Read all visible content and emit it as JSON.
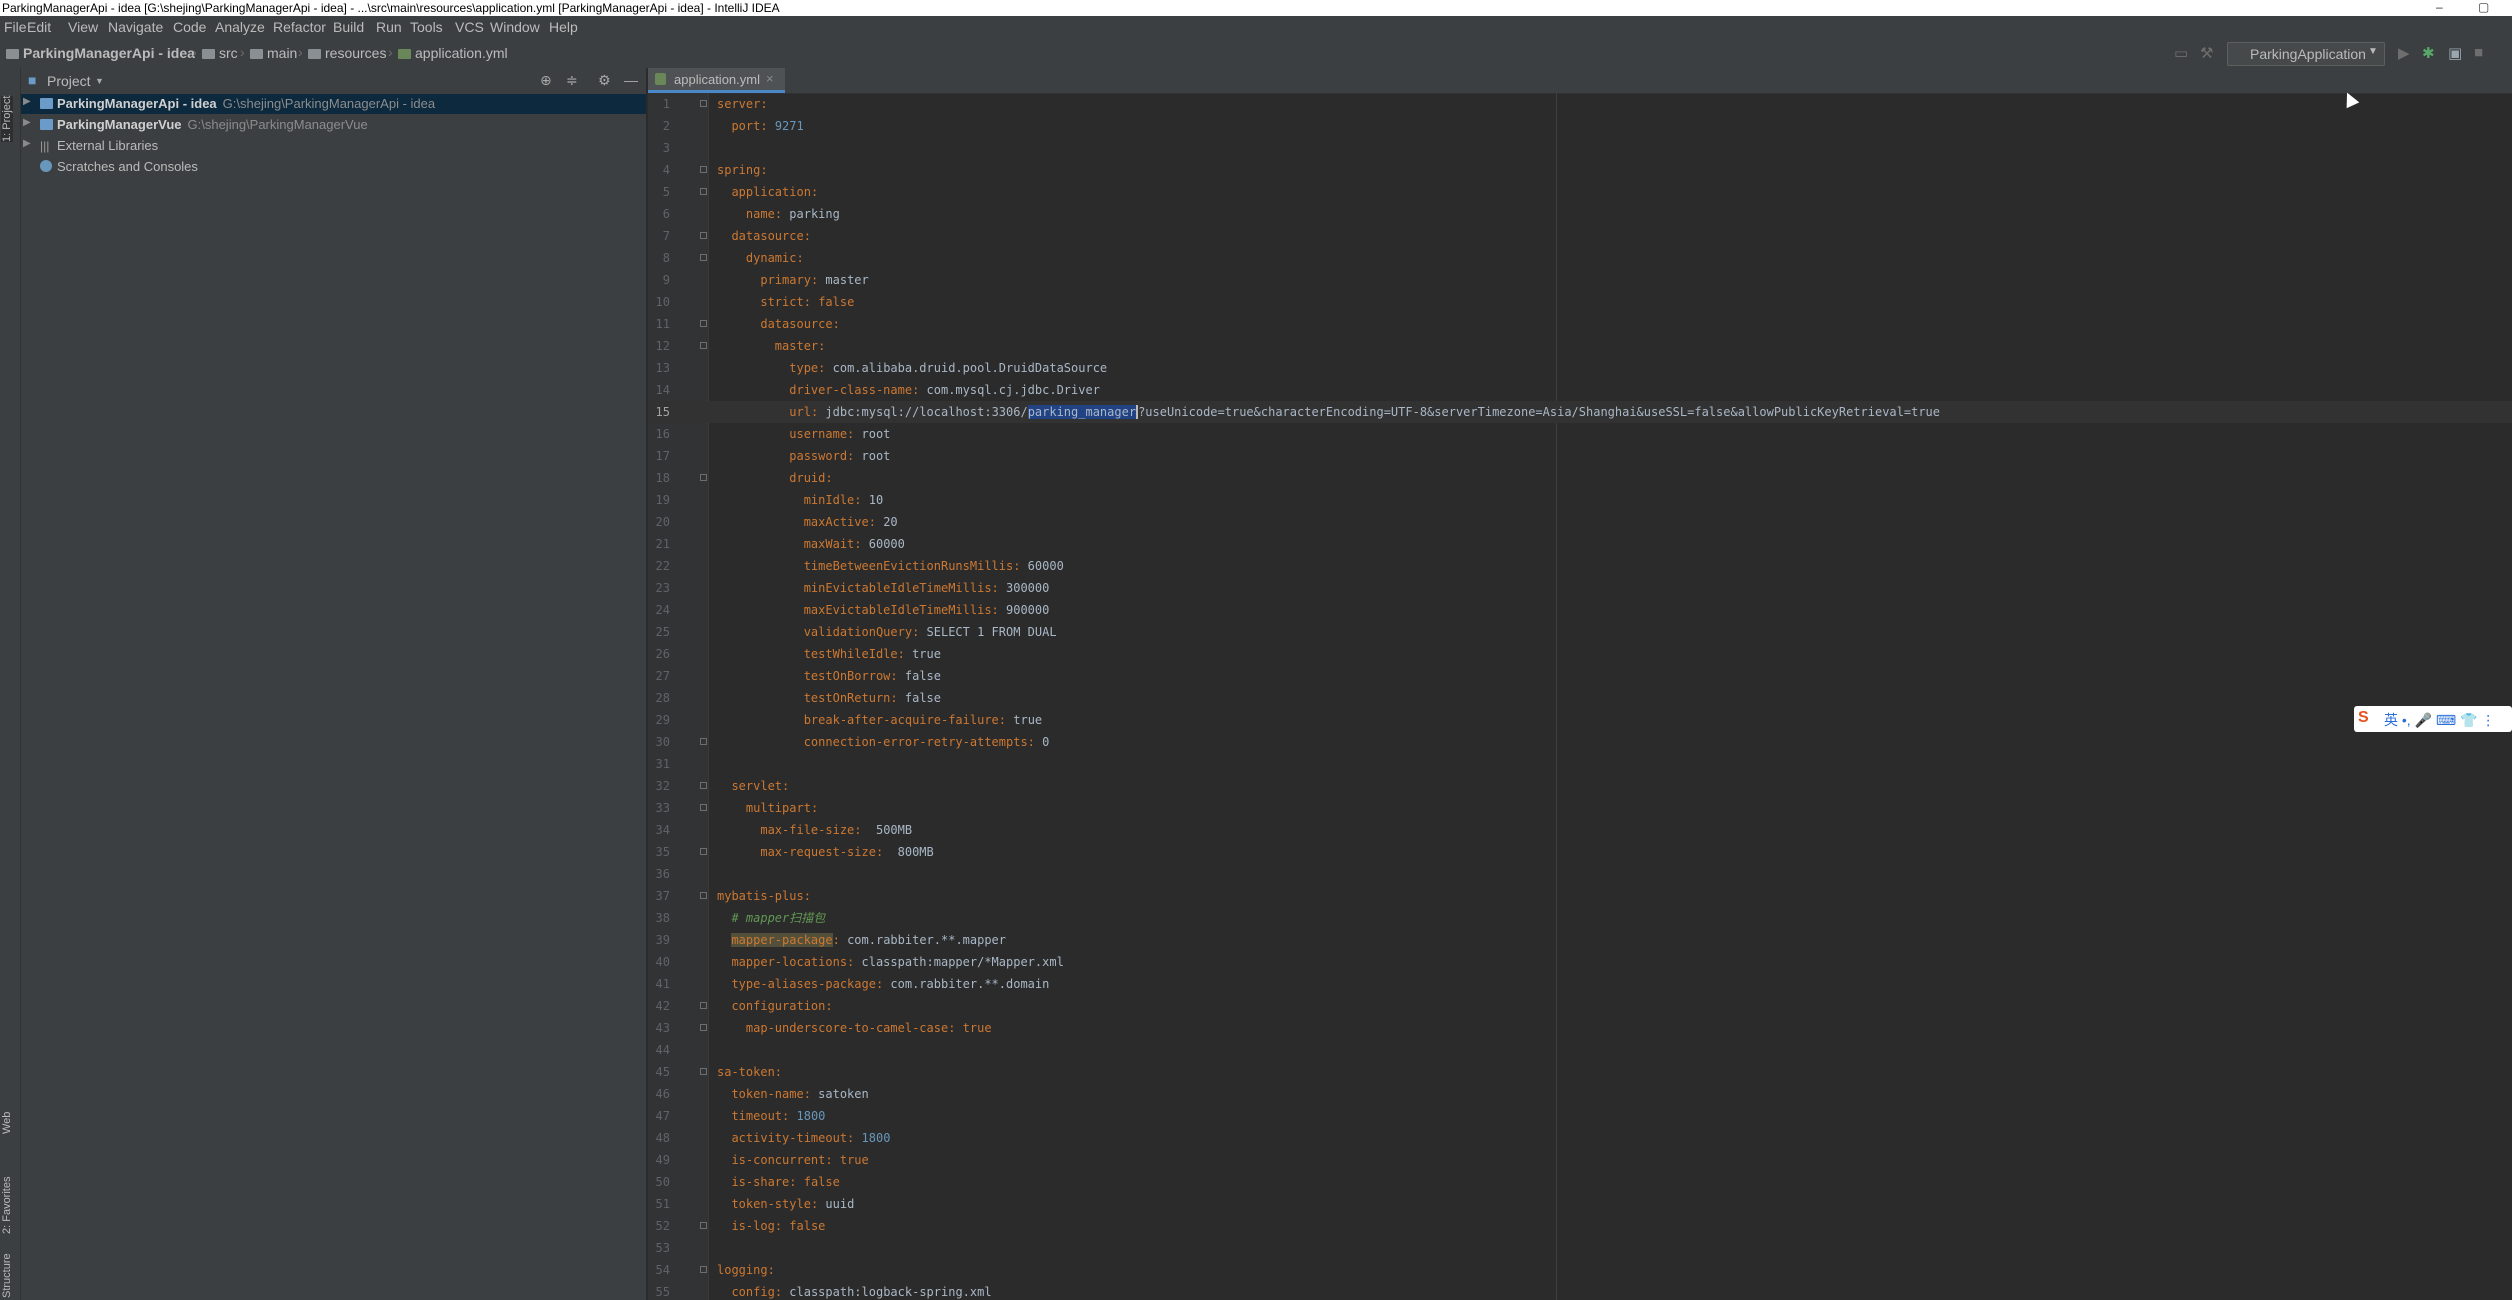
{
  "window": {
    "title": "ParkingManagerApi - idea [G:\\shejing\\ParkingManagerApi - idea] - ...\\src\\main\\resources\\application.yml [ParkingManagerApi - idea] - IntelliJ IDEA",
    "minimize": "–",
    "maximize": "▢"
  },
  "menu": [
    "File",
    "Edit",
    "View",
    "Navigate",
    "Code",
    "Analyze",
    "Refactor",
    "Build",
    "Run",
    "Tools",
    "VCS",
    "Window",
    "Help"
  ],
  "breadcrumb": [
    "ParkingManagerApi - idea",
    "src",
    "main",
    "resources",
    "application.yml"
  ],
  "run_config": "ParkingApplication",
  "project_panel": {
    "title": "Project",
    "items": [
      {
        "name": "ParkingManagerApi - idea",
        "path": "G:\\shejing\\ParkingManagerApi - idea"
      },
      {
        "name": "ParkingManagerVue",
        "path": "G:\\shejing\\ParkingManagerVue"
      },
      {
        "name": "External Libraries",
        "path": ""
      },
      {
        "name": "Scratches and Consoles",
        "path": ""
      }
    ]
  },
  "side_tabs": {
    "project": "1: Project",
    "web": "Web",
    "favorites": "2: Favorites",
    "structure": "Structure"
  },
  "editor": {
    "tab": "application.yml",
    "current_line": 15,
    "lines": [
      "server:",
      "  port: 9271",
      "",
      "spring:",
      "  application:",
      "    name: parking",
      "  datasource:",
      "    dynamic:",
      "      primary: master",
      "      strict: false",
      "      datasource:",
      "        master:",
      "          type: com.alibaba.druid.pool.DruidDataSource",
      "          driver-class-name: com.mysql.cj.jdbc.Driver",
      "          url: jdbc:mysql://localhost:3306/parking_manager?useUnicode=true&characterEncoding=UTF-8&serverTimezone=Asia/Shanghai&useSSL=false&allowPublicKeyRetrieval=true",
      "          username: root",
      "          password: root",
      "          druid:",
      "            minIdle: 10",
      "            maxActive: 20",
      "            maxWait: 60000",
      "            timeBetweenEvictionRunsMillis: 60000",
      "            minEvictableIdleTimeMillis: 300000",
      "            maxEvictableIdleTimeMillis: 900000",
      "            validationQuery: SELECT 1 FROM DUAL",
      "            testWhileIdle: true",
      "            testOnBorrow: false",
      "            testOnReturn: false",
      "            break-after-acquire-failure: true",
      "            connection-error-retry-attempts: 0",
      "",
      "  servlet:",
      "    multipart:",
      "      max-file-size:  500MB",
      "      max-request-size:  800MB",
      "",
      "mybatis-plus:",
      "  # mapper扫描包",
      "  mapper-package: com.rabbiter.**.mapper",
      "  mapper-locations: classpath:mapper/*Mapper.xml",
      "  type-aliases-package: com.rabbiter.**.domain",
      "  configuration:",
      "    map-underscore-to-camel-case: true",
      "",
      "sa-token:",
      "  token-name: satoken",
      "  timeout: 1800",
      "  activity-timeout: 1800",
      "  is-concurrent: true",
      "  is-share: false",
      "  token-style: uuid",
      "  is-log: false",
      "",
      "logging:",
      "  config: classpath:logback-spring.xml"
    ]
  },
  "ime": {
    "logo": "S",
    "text": "英 •, 🎤 ⌨ 👕 ⋮"
  },
  "colors": {
    "key": "#cc7832",
    "value": "#a9b7c6",
    "number": "#6897bb",
    "comment": "#629755",
    "selection": "#214283"
  }
}
